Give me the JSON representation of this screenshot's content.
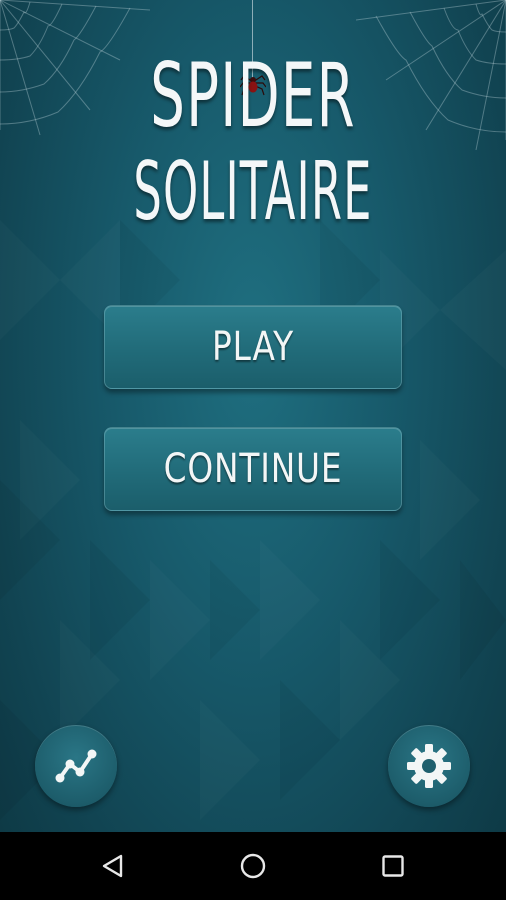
{
  "game": {
    "title_line1": "SPIDER",
    "title_line2": "SOLITAIRE"
  },
  "menu": {
    "play_label": "PLAY",
    "continue_label": "CONTINUE"
  },
  "footer": {
    "stats_icon": "statistics-graph-icon",
    "settings_icon": "gear-icon"
  },
  "navbar": {
    "back_icon": "back-triangle-icon",
    "home_icon": "home-circle-icon",
    "recents_icon": "recents-square-icon"
  },
  "colors": {
    "background": "#17596a",
    "button": "#216b79",
    "text": "#f4f7f8",
    "navbar": "#000000"
  }
}
